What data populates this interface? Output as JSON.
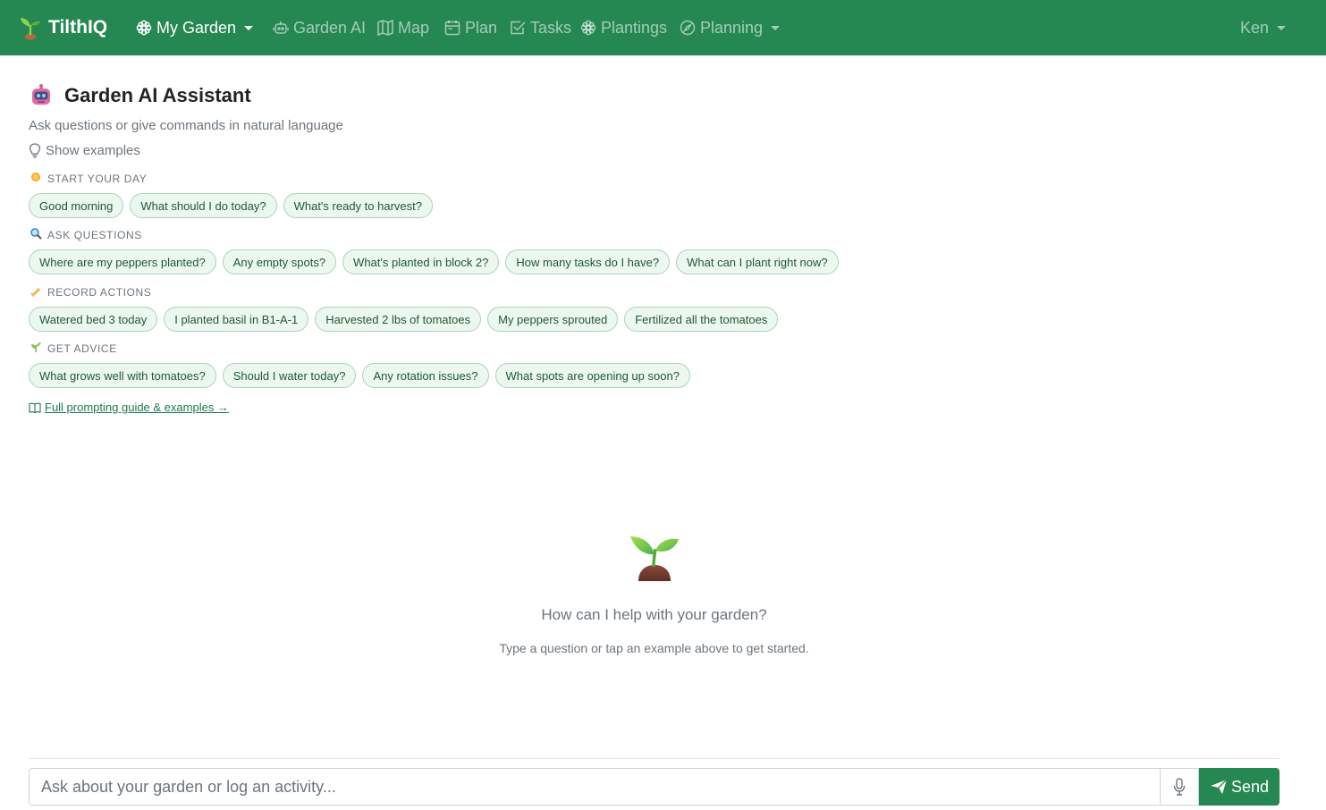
{
  "app": {
    "brand": "TilthIQ",
    "colors": {
      "primary": "#258751",
      "chip_bg": "#ecf7ef",
      "chip_border": "#a8d5b8",
      "chip_text": "#1e5a36"
    }
  },
  "nav": {
    "items": [
      {
        "label": "My Garden",
        "icon": "flower-icon",
        "dropdown": true,
        "active": true
      },
      {
        "label": "Garden AI",
        "icon": "robot-icon"
      },
      {
        "label": "Map",
        "icon": "map-icon"
      },
      {
        "label": "Plan",
        "icon": "calendar-icon"
      },
      {
        "label": "Tasks",
        "icon": "check-square-icon"
      },
      {
        "label": "Plantings",
        "icon": "flower-icon"
      },
      {
        "label": "Planning",
        "icon": "compass-icon",
        "dropdown": true
      }
    ],
    "user": "Ken"
  },
  "header": {
    "icon": "robot-emoji-icon",
    "title": "Garden AI Assistant",
    "subtitle": "Ask questions or give commands in natural language",
    "show_examples": "Show examples"
  },
  "sections": [
    {
      "label": "START YOUR DAY",
      "icon": "sun-icon",
      "chips": [
        "Good morning",
        "What should I do today?",
        "What's ready to harvest?"
      ]
    },
    {
      "label": "ASK QUESTIONS",
      "icon": "magnifier-icon",
      "chips": [
        "Where are my peppers planted?",
        "Any empty spots?",
        "What's planted in block 2?",
        "How many tasks do I have?",
        "What can I plant right now?"
      ]
    },
    {
      "label": "RECORD ACTIONS",
      "icon": "writing-hand-icon",
      "chips": [
        "Watered bed 3 today",
        "I planted basil in B1-A-1",
        "Harvested 2 lbs of tomatoes",
        "My peppers sprouted",
        "Fertilized all the tomatoes"
      ]
    },
    {
      "label": "GET ADVICE",
      "icon": "herb-icon",
      "chips": [
        "What grows well with tomatoes?",
        "Should I water today?",
        "Any rotation issues?",
        "What spots are opening up soon?"
      ]
    }
  ],
  "guide_link": "Full prompting guide & examples →",
  "empty_state": {
    "icon": "seedling-icon",
    "title": "How can I help with your garden?",
    "subtitle": "Type a question or tap an example above to get started."
  },
  "composer": {
    "placeholder": "Ask about your garden or log an activity...",
    "send_label": "Send"
  }
}
